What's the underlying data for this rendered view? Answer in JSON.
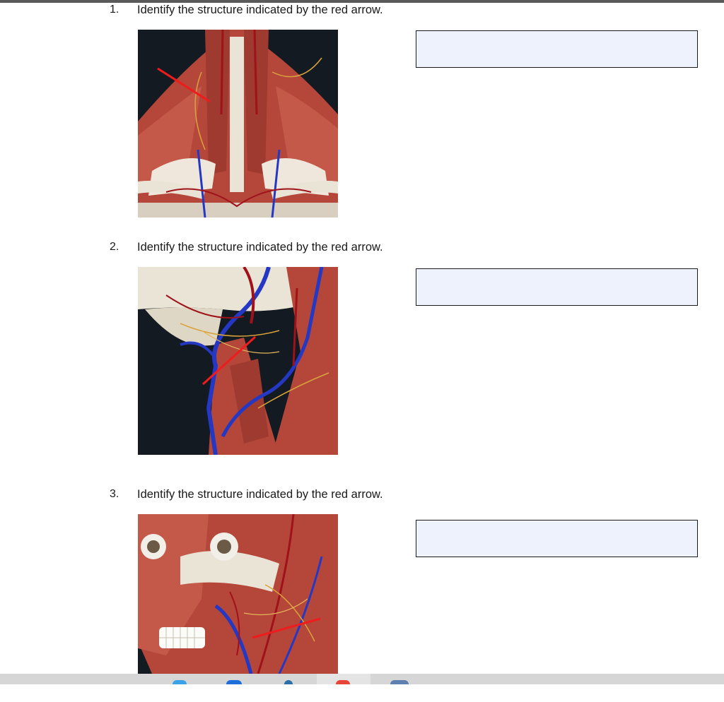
{
  "questions": [
    {
      "number": "1.",
      "text": "Identify the structure indicated by the red arrow.",
      "answer_value": "",
      "image_alt": "Anterior neck muscles"
    },
    {
      "number": "2.",
      "text": "Identify the structure indicated by the red arrow.",
      "answer_value": "",
      "image_alt": "Lateral neck vessels and nerves"
    },
    {
      "number": "3.",
      "text": "Identify the structure indicated by the red arrow.",
      "answer_value": "",
      "image_alt": "Facial muscles and vessels"
    }
  ],
  "colors": {
    "answer_fill": "#eef2fc",
    "arrow": "#ee1c1c",
    "muscle": "#b5473a",
    "bone": "#e9e4d6",
    "vein": "#2438c4",
    "background_dark": "#141a22"
  },
  "taskbar_icons": [
    "edge-icon",
    "chrome-icon",
    "app-icon-blue",
    "app-icon-red",
    "app-icon-store"
  ]
}
